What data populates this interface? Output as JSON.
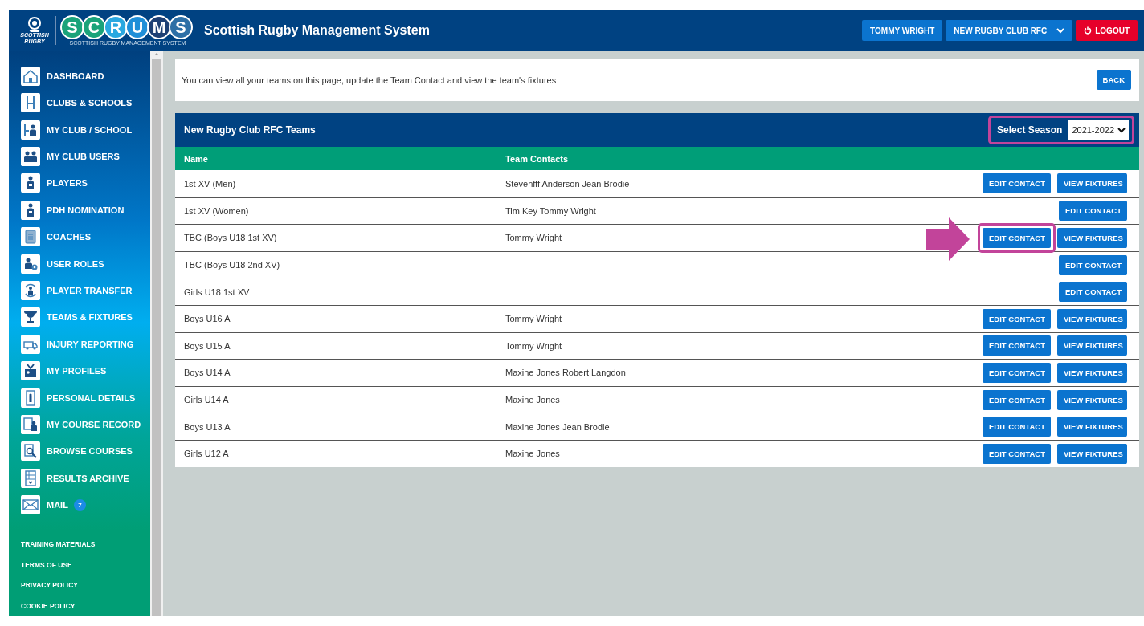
{
  "header": {
    "crest_text": "SCOTTISH RUGBY",
    "logo_letters": [
      {
        "letter": "S",
        "color": "#1aa37a"
      },
      {
        "letter": "C",
        "color": "#1aa37a"
      },
      {
        "letter": "R",
        "color": "#2aa8e0"
      },
      {
        "letter": "U",
        "color": "#1f8fd8"
      },
      {
        "letter": "M",
        "color": "#1d3f73"
      },
      {
        "letter": "S",
        "color": "#2d6fa6"
      }
    ],
    "logo_subtitle": "SCOTTISH RUGBY MANAGEMENT SYSTEM",
    "title": "Scottish Rugby Management System",
    "user_button": "TOMMY WRIGHT",
    "club_select": "NEW RUGBY CLUB RFC",
    "logout_button": "LOGOUT"
  },
  "sidebar": {
    "items": [
      {
        "label": "DASHBOARD"
      },
      {
        "label": "CLUBS & SCHOOLS"
      },
      {
        "label": "MY CLUB / SCHOOL"
      },
      {
        "label": "MY CLUB USERS"
      },
      {
        "label": "PLAYERS"
      },
      {
        "label": "PDH NOMINATION"
      },
      {
        "label": "COACHES"
      },
      {
        "label": "USER ROLES"
      },
      {
        "label": "PLAYER TRANSFER"
      },
      {
        "label": "TEAMS & FIXTURES"
      },
      {
        "label": "INJURY REPORTING"
      },
      {
        "label": "MY PROFILES"
      },
      {
        "label": "PERSONAL DETAILS"
      },
      {
        "label": "MY COURSE RECORD"
      },
      {
        "label": "BROWSE COURSES"
      },
      {
        "label": "RESULTS ARCHIVE"
      },
      {
        "label": "MAIL",
        "badge": "7"
      }
    ],
    "links": [
      "TRAINING MATERIALS",
      "TERMS OF USE",
      "PRIVACY POLICY",
      "COOKIE POLICY"
    ]
  },
  "info": {
    "text": "You can view all your teams on this page, update the Team Contact and view the team's fixtures",
    "back_button": "BACK"
  },
  "teams": {
    "title": "New Rugby Club RFC Teams",
    "season_label": "Select Season",
    "season_value": "2021-2022",
    "season_highlighted": true,
    "columns": [
      "Name",
      "Team Contacts"
    ],
    "rows": [
      {
        "name": "1st XV (Men)",
        "contacts": "Stevenfff Anderson Jean Brodie",
        "actions": [
          {
            "label": "EDIT CONTACT",
            "highlighted": false
          },
          {
            "label": "VIEW FIXTURES",
            "highlighted": false
          }
        ]
      },
      {
        "name": "1st XV (Women)",
        "contacts": "Tim Key Tommy Wright",
        "actions": [
          {
            "label": "EDIT CONTACT",
            "highlighted": false
          }
        ]
      },
      {
        "name": "TBC (Boys U18 1st XV)",
        "contacts": "Tommy Wright",
        "actions": [
          {
            "label": "EDIT CONTACT",
            "highlighted": true
          },
          {
            "label": "VIEW FIXTURES",
            "highlighted": false
          }
        ]
      },
      {
        "name": "TBC (Boys U18 2nd XV)",
        "actions": [
          {
            "label": "EDIT CONTACT",
            "highlighted": false
          }
        ]
      },
      {
        "name": "Girls U18 1st XV",
        "actions": [
          {
            "label": "EDIT CONTACT",
            "highlighted": false
          }
        ]
      },
      {
        "name": "Boys U16 A",
        "contacts": "Tommy Wright",
        "actions": [
          {
            "label": "EDIT CONTACT",
            "highlighted": false
          },
          {
            "label": "VIEW FIXTURES",
            "highlighted": false
          }
        ]
      },
      {
        "name": "Boys U15 A",
        "contacts": "Tommy Wright",
        "actions": [
          {
            "label": "EDIT CONTACT",
            "highlighted": false
          },
          {
            "label": "VIEW FIXTURES",
            "highlighted": false
          }
        ]
      },
      {
        "name": "Boys U14 A",
        "contacts": "Maxine Jones Robert Langdon",
        "actions": [
          {
            "label": "EDIT CONTACT",
            "highlighted": false
          },
          {
            "label": "VIEW FIXTURES",
            "highlighted": false
          }
        ]
      },
      {
        "name": "Girls U14 A",
        "contacts": "Maxine Jones",
        "actions": [
          {
            "label": "EDIT CONTACT",
            "highlighted": false
          },
          {
            "label": "VIEW FIXTURES",
            "highlighted": false
          }
        ]
      },
      {
        "name": "Boys U13 A",
        "contacts": "Maxine Jones Jean Brodie",
        "actions": [
          {
            "label": "EDIT CONTACT",
            "highlighted": false
          },
          {
            "label": "VIEW FIXTURES",
            "highlighted": false
          }
        ]
      },
      {
        "name": "Girls U12 A",
        "contacts": "Maxine Jones",
        "actions": [
          {
            "label": "EDIT CONTACT",
            "highlighted": false
          },
          {
            "label": "VIEW FIXTURES",
            "highlighted": false
          }
        ]
      }
    ]
  }
}
